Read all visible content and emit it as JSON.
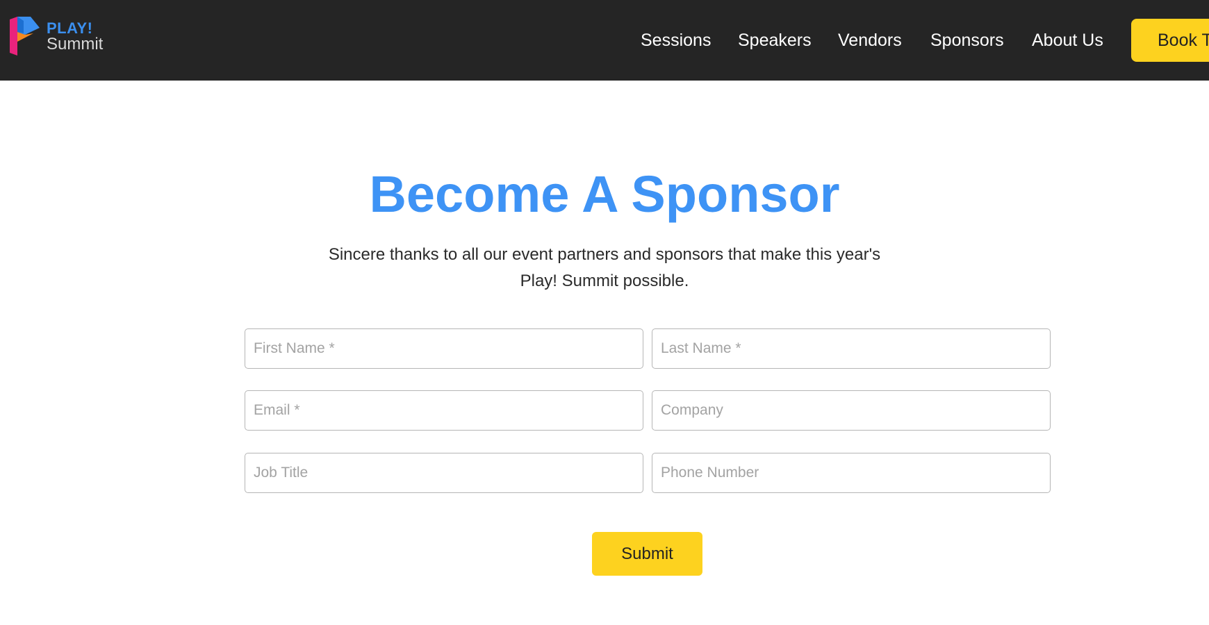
{
  "header": {
    "logo": {
      "line1": "PLAY!",
      "line2": "Summit",
      "icon": "play-summit-logo-icon"
    },
    "nav": [
      {
        "label": "Sessions"
      },
      {
        "label": "Speakers"
      },
      {
        "label": "Vendors"
      },
      {
        "label": "Sponsors"
      },
      {
        "label": "About Us"
      }
    ],
    "cta_label": "Book T"
  },
  "main": {
    "title": "Become A Sponsor",
    "subtitle": "Sincere thanks to all our event partners and sponsors that make this year's Play! Summit possible.",
    "form": {
      "first_name_placeholder": "First Name *",
      "last_name_placeholder": "Last Name *",
      "email_placeholder": "Email *",
      "company_placeholder": "Company",
      "job_title_placeholder": "Job Title",
      "phone_placeholder": "Phone Number",
      "submit_label": "Submit"
    }
  },
  "colors": {
    "header_bg": "#252525",
    "accent_yellow": "#fdd21f",
    "title_blue": "#3e93f5",
    "logo_blue": "#3b8fef",
    "logo_pink": "#e9237c",
    "logo_orange": "#f58a1f"
  }
}
